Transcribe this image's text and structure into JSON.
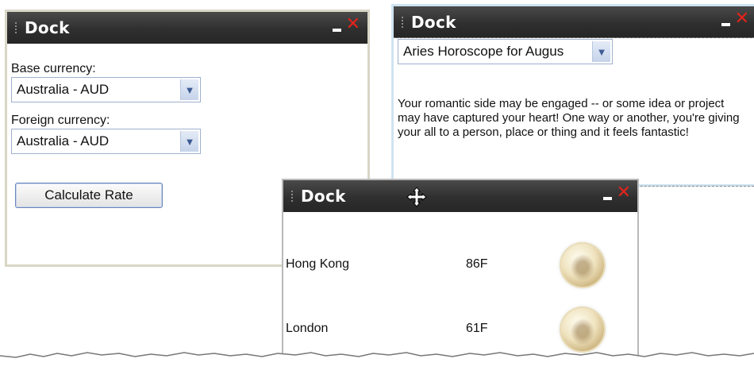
{
  "currency_dock": {
    "title": "Dock",
    "base_label": "Base currency:",
    "base_value": "Australia - AUD",
    "foreign_label": "Foreign currency:",
    "foreign_value": "Australia - AUD",
    "calculate_label": "Calculate Rate"
  },
  "horoscope_dock": {
    "title": "Dock",
    "select_value": "Aries Horoscope for Augus",
    "text": "Your romantic side may be engaged -- or some idea or project may have captured your heart! One way or another, you're giving your all to a person, place or thing and it feels fantastic!"
  },
  "weather_dock": {
    "title": "Dock",
    "rows": [
      {
        "city": "Hong Kong",
        "temp": "86F",
        "icon": "cloudy-moon-icon"
      },
      {
        "city": "London",
        "temp": "61F",
        "icon": "cloudy-moon-icon"
      }
    ]
  },
  "colors": {
    "titlebar": "#2f2f2f",
    "close": "#e3231b"
  },
  "icons": {
    "minimize": "minimize-icon",
    "close": "close-icon",
    "dropdown": "chevron-down-icon",
    "move": "move-cursor-icon"
  }
}
